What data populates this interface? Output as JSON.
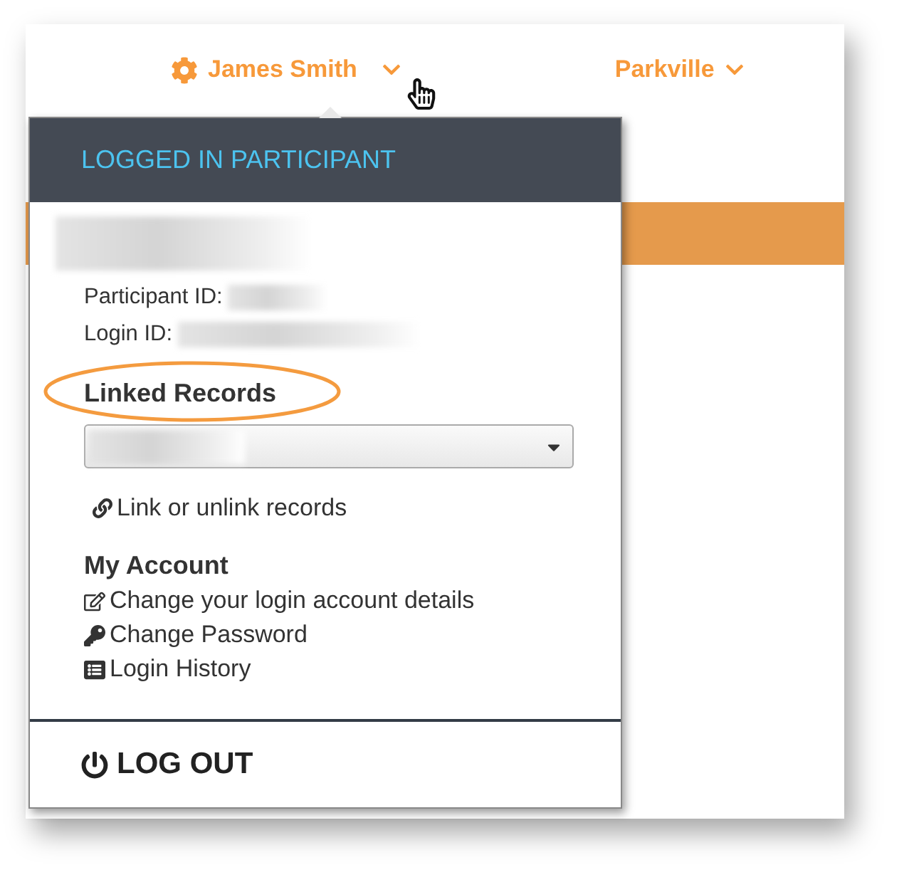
{
  "nav": [
    {
      "label": "James Smith",
      "kind": "account"
    },
    {
      "label": "Parkville",
      "kind": "site"
    }
  ],
  "menu": {
    "header": "LOGGED IN PARTICIPANT",
    "fields": [
      {
        "label": "Participant ID:"
      },
      {
        "label": "Login ID:"
      }
    ],
    "linked_records": {
      "heading": "Linked Records",
      "highlighted": true,
      "link": "Link or unlink records"
    },
    "account": {
      "heading": "My Account",
      "links": [
        {
          "kind": "edit",
          "label": "Change your login account details"
        },
        {
          "kind": "key",
          "label": "Change Password"
        },
        {
          "kind": "list",
          "label": "Login History"
        }
      ]
    },
    "logout": "LOG OUT"
  }
}
